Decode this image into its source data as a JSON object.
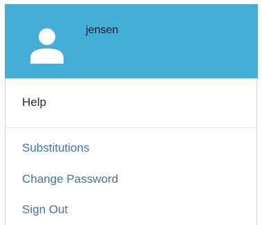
{
  "user": {
    "name": "jensen",
    "icon": "user-icon",
    "header_color": "#45aed7"
  },
  "menu": {
    "help_label": "Help",
    "links": [
      {
        "label": "Substitutions"
      },
      {
        "label": "Change Password"
      },
      {
        "label": "Sign Out"
      }
    ],
    "link_color": "#3f74b3"
  }
}
